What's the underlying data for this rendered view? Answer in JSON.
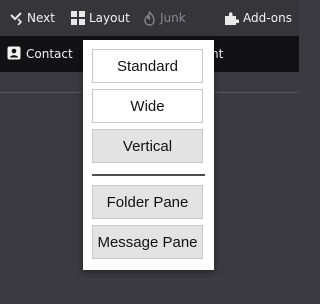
{
  "toolbar": {
    "next_label": "Next",
    "layout_label": "Layout",
    "junk_label": "Junk",
    "addons_label": "Add-ons"
  },
  "secondary_toolbar": {
    "contact_label": "Contact",
    "partial_label": "nt"
  },
  "layout_menu": {
    "items": [
      "Standard",
      "Wide",
      "Vertical"
    ],
    "pane_items": [
      "Folder Pane",
      "Message Pane"
    ]
  },
  "icons": {
    "next": "next-arrow-icon",
    "layout": "layout-grid-icon",
    "junk": "junk-flame-icon",
    "addons": "puzzle-piece-icon",
    "contact": "contact-card-icon"
  },
  "colors": {
    "toolbar_bg": "#36353a",
    "secondary_bar_bg": "#121214",
    "content_bg": "#3b3a40",
    "menu_bg": "#ffffff",
    "menu_item_shaded": "#e3e3e3"
  }
}
